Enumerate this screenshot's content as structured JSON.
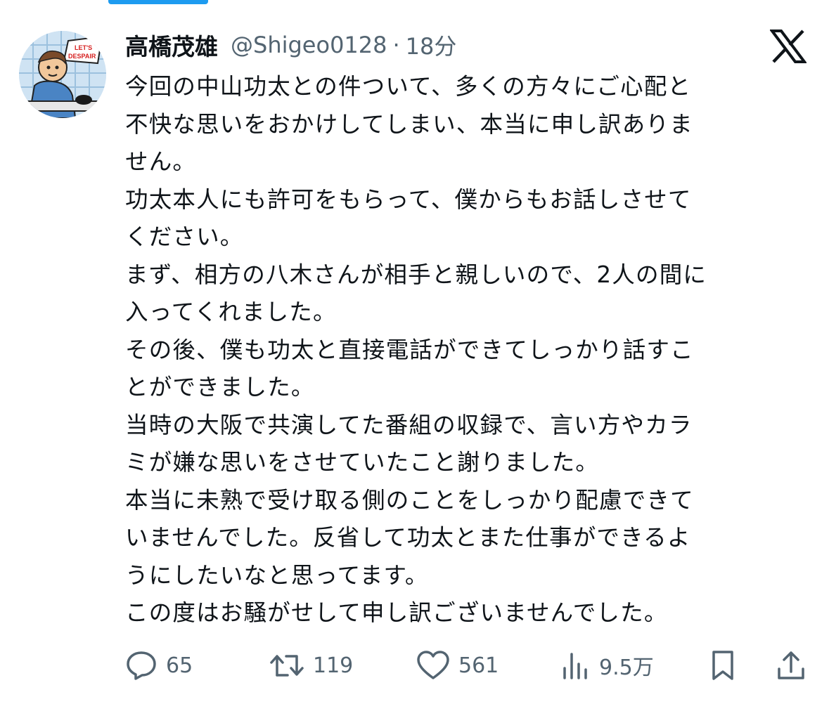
{
  "tweet": {
    "author": {
      "display_name": "高橋茂雄",
      "handle": "@Shigeo0128",
      "separator": "·",
      "time": "18分",
      "avatar_text": "LET'S DESPAIR"
    },
    "lines": [
      "今回の中山功太との件ついて、多くの方々にご心配と",
      "不快な思いをおかけしてしまい、本当に申し訳ありま",
      "せん。",
      "功太本人にも許可をもらって、僕からもお話しさせて",
      "ください。",
      "まず、相方の八木さんが相手と親しいので、2人の間に",
      "入ってくれました。",
      "その後、僕も功太と直接電話ができてしっかり話すこ",
      "とができました。",
      "当時の大阪で共演してた番組の収録で、言い方やカラ",
      "ミが嫌な思いをさせていたこと謝りました。",
      "本当に未熟で受け取る側のことをしっかり配慮できて",
      "いませんでした。反省して功太とまた仕事ができるよ",
      "うにしたいなと思ってます。",
      "この度はお騒がせして申し訳ございませんでした。"
    ],
    "stats": {
      "replies": "65",
      "retweets": "119",
      "likes": "561",
      "views": "9.5万"
    }
  },
  "colors": {
    "text": "#0f1419",
    "secondary": "#536471",
    "accent": "#1d9bf0"
  },
  "icons": [
    "reply-icon",
    "retweet-icon",
    "like-icon",
    "views-icon",
    "bookmark-icon",
    "share-icon",
    "x-logo-icon"
  ]
}
